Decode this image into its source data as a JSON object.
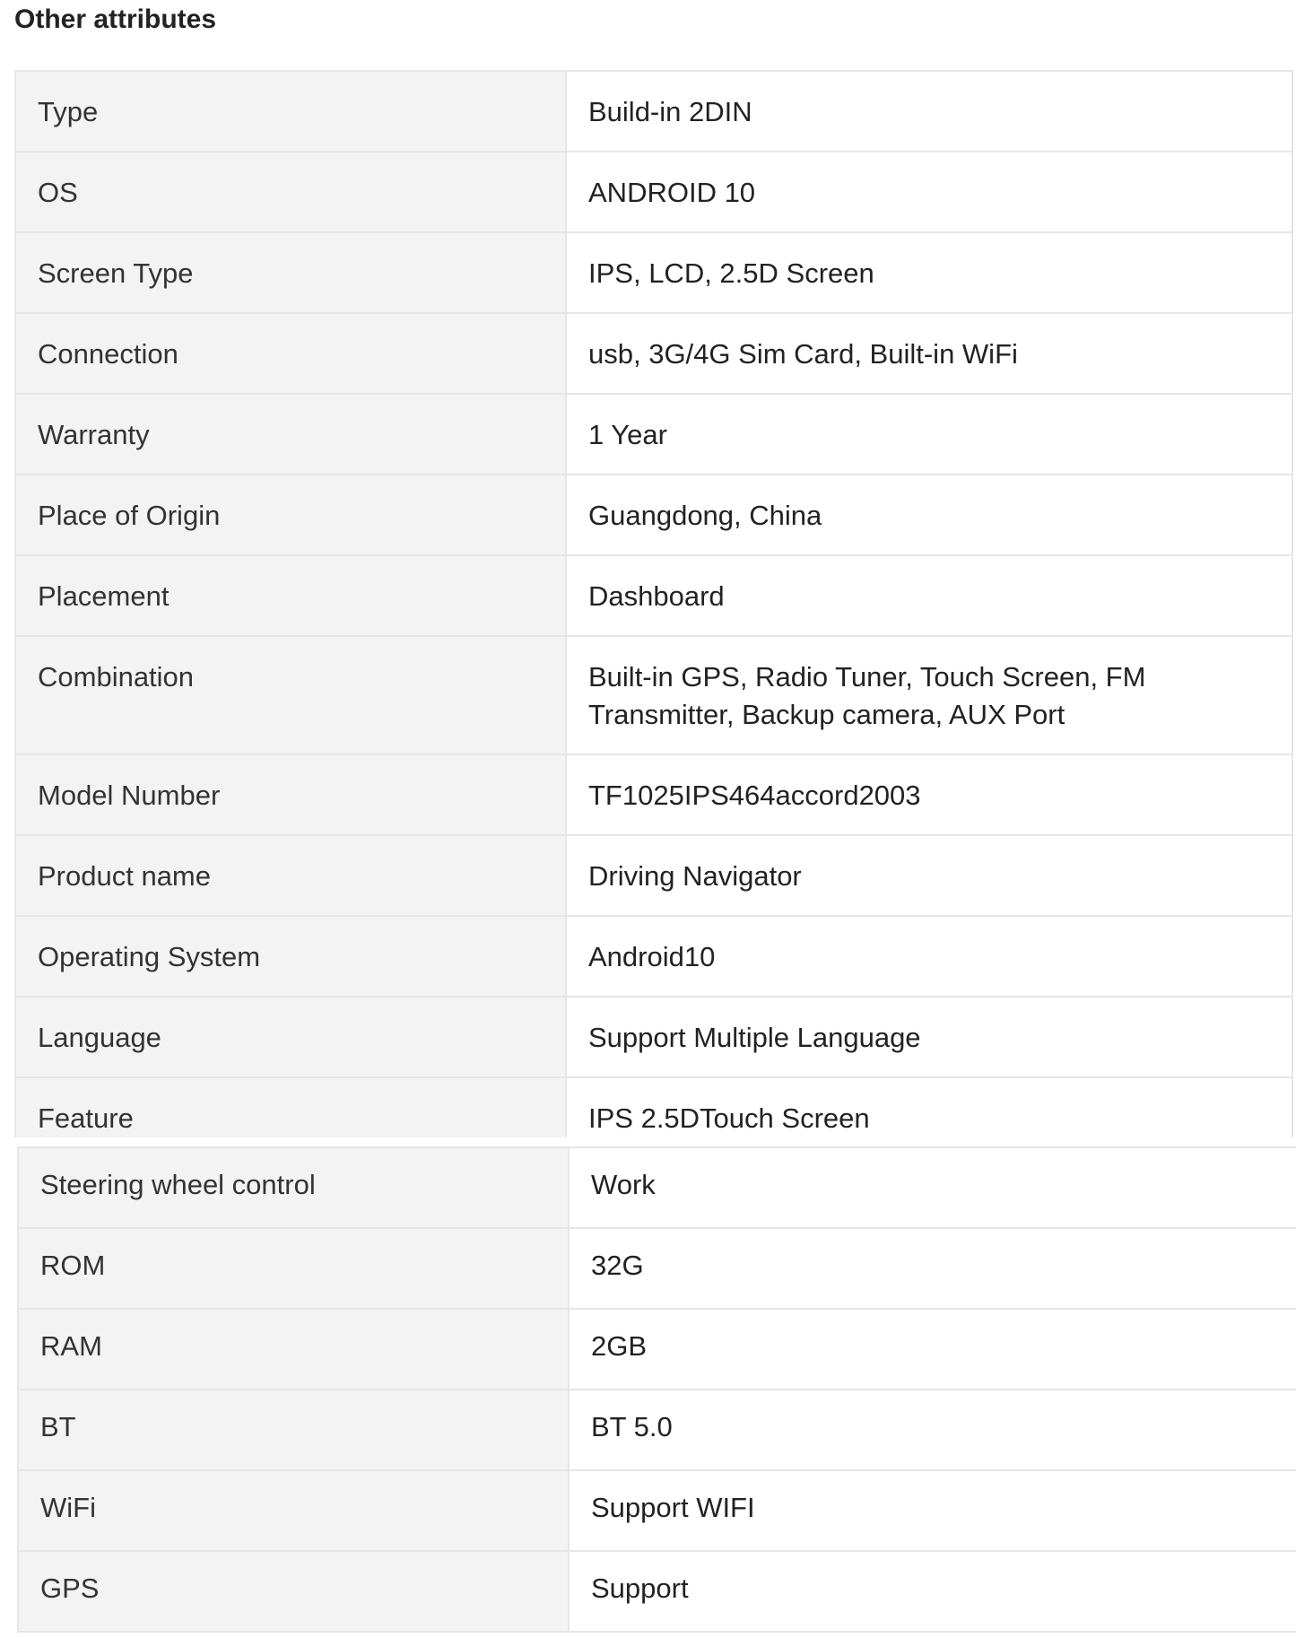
{
  "section": {
    "title": "Other attributes"
  },
  "table1": [
    {
      "key": "Type",
      "value": "Build-in 2DIN"
    },
    {
      "key": "OS",
      "value": "ANDROID 10"
    },
    {
      "key": "Screen Type",
      "value": "IPS, LCD, 2.5D Screen"
    },
    {
      "key": "Connection",
      "value": "usb, 3G/4G Sim Card, Built-in WiFi"
    },
    {
      "key": "Warranty",
      "value": "1 Year"
    },
    {
      "key": "Place of Origin",
      "value": "Guangdong, China"
    },
    {
      "key": "Placement",
      "value": "Dashboard"
    },
    {
      "key": "Combination",
      "value": "Built-in GPS, Radio Tuner, Touch Screen, FM Transmitter, Backup camera, AUX Port"
    },
    {
      "key": "Model Number",
      "value": "TF1025IPS464accord2003"
    },
    {
      "key": "Product name",
      "value": "Driving Navigator"
    },
    {
      "key": "Operating System",
      "value": "Android10"
    },
    {
      "key": "Language",
      "value": "Support Multiple Language"
    },
    {
      "key": "Feature",
      "value": "IPS 2.5DTouch Screen"
    }
  ],
  "table2": [
    {
      "key": "Steering wheel control",
      "value": "Work"
    },
    {
      "key": "ROM",
      "value": "32G"
    },
    {
      "key": "RAM",
      "value": "2GB"
    },
    {
      "key": "BT",
      "value": "BT 5.0"
    },
    {
      "key": "WiFi",
      "value": "Support WIFI"
    },
    {
      "key": "GPS",
      "value": "Support"
    }
  ]
}
